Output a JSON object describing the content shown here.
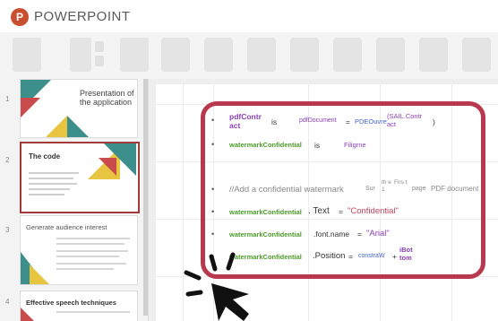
{
  "app": {
    "title": "POWERPOINT",
    "logo_letter": "P",
    "accent": "#c9502f"
  },
  "highlight_color": "#b8394f",
  "thumbnails": [
    {
      "number": "1",
      "title": "Presentation of the application"
    },
    {
      "number": "2",
      "title": "The code",
      "lines": [
        "",
        "",
        "",
        "",
        ""
      ]
    },
    {
      "number": "3",
      "title": "Generate audience interest"
    },
    {
      "number": "4",
      "title": "Effective speech techniques"
    }
  ],
  "code": {
    "line1": {
      "a": "pdfContr act",
      "b": "is",
      "c": "pdfDocument",
      "d": "=",
      "e": "PDEOuvre",
      "f": "(SAIL.Contr act",
      "g": ")"
    },
    "line2": {
      "a": "watermarkConfidential",
      "b": "is",
      "c": "Filigrne"
    },
    "line3": {
      "a": "//Add a confidential watermark",
      "b": "Sur",
      "c": "th e 1",
      "d": "Firs t",
      "e": "page",
      "f": "PDF document"
    },
    "line4": {
      "a": "watermarkConfidential",
      "b": ". Text",
      "c": "=",
      "d": "\"Confidential\""
    },
    "line5": {
      "a": "watermarkConfidential",
      "b": ".font.name",
      "c": "=",
      "d": "\"Arial\""
    },
    "line6": {
      "a": "watermarkConfidential",
      "b": ".Position",
      "c": "=",
      "d": "constraW",
      "e": "+",
      "f": "iBot tom"
    }
  }
}
